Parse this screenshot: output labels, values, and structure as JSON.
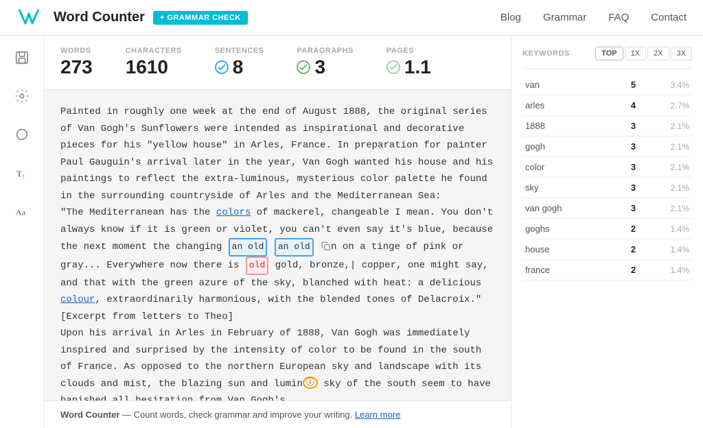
{
  "header": {
    "title": "Word Counter",
    "grammar_check_label": "+ GRAMMAR CHECK",
    "nav": [
      "Blog",
      "Grammar",
      "FAQ",
      "Contact"
    ]
  },
  "stats": {
    "words_label": "WORDS",
    "words_value": "273",
    "characters_label": "CHARACTERS",
    "characters_value": "1610",
    "sentences_label": "SENTENCES",
    "sentences_value": "8",
    "paragraphs_label": "PARAGRAPHS",
    "paragraphs_value": "3",
    "pages_label": "PAGES",
    "pages_value": "1.1"
  },
  "keywords": {
    "label": "KEYWORDS",
    "tabs": [
      "TOP",
      "1X",
      "2X",
      "3X"
    ],
    "active_tab": "TOP",
    "rows": [
      {
        "word": "van",
        "count": "5",
        "pct": "3.4%"
      },
      {
        "word": "arles",
        "count": "4",
        "pct": "2.7%"
      },
      {
        "word": "1888",
        "count": "3",
        "pct": "2.1%"
      },
      {
        "word": "gogh",
        "count": "3",
        "pct": "2.1%"
      },
      {
        "word": "color",
        "count": "3",
        "pct": "2.1%"
      },
      {
        "word": "sky",
        "count": "3",
        "pct": "2.1%"
      },
      {
        "word": "van gogh",
        "count": "3",
        "pct": "2.1%"
      },
      {
        "word": "goghs",
        "count": "2",
        "pct": "1.4%"
      },
      {
        "word": "house",
        "count": "2",
        "pct": "1.4%"
      },
      {
        "word": "france",
        "count": "2",
        "pct": "1.4%"
      }
    ]
  },
  "footer": {
    "text": "Word Counter",
    "separator": " — ",
    "description": "Count words, check grammar and improve your writing.",
    "link_text": "Learn more"
  },
  "sidebar_icons": [
    {
      "name": "save-icon",
      "unicode": "💾"
    },
    {
      "name": "settings-icon",
      "unicode": "⚙"
    },
    {
      "name": "circle-icon",
      "unicode": "◯"
    },
    {
      "name": "font-size-icon",
      "unicode": "T"
    },
    {
      "name": "font-style-icon",
      "unicode": "Aa"
    }
  ]
}
